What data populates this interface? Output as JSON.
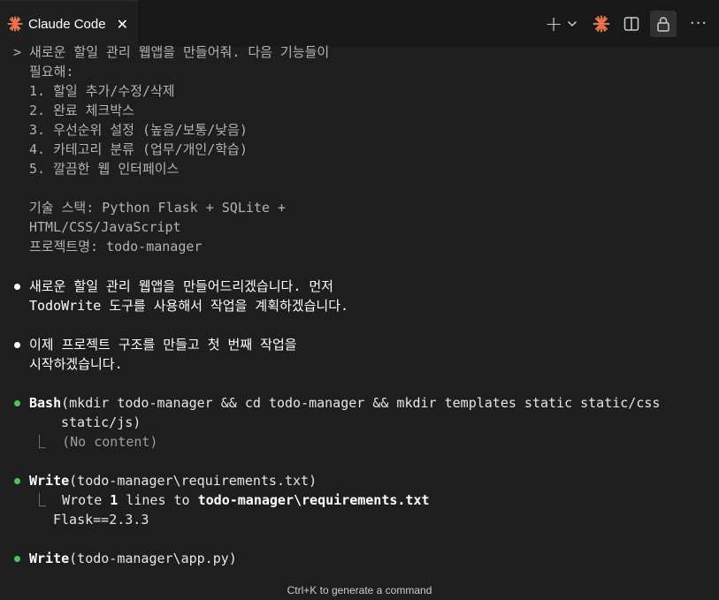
{
  "tab": {
    "title": "Claude Code",
    "close_glyph": "✕"
  },
  "actions": {
    "plus": "+",
    "more": "···"
  },
  "colors": {
    "accent_orange": "#e8734a",
    "bullet_green": "#4ec35a",
    "background": "#1e1e1e"
  },
  "conversation": {
    "prompt_marker": ">",
    "user_lines": [
      "새로운 할일 관리 웹앱을 만들어줘. 다음 기능들이",
      "필요해:",
      "1. 할일 추가/수정/삭제",
      "2. 완료 체크박스",
      "3. 우선순위 설정 (높음/보통/낮음)",
      "4. 카테고리 분류 (업무/개인/학습)",
      "5. 깔끔한 웹 인터페이스",
      "",
      "기술 스택: Python Flask + SQLite +",
      "HTML/CSS/JavaScript",
      "프로젝트명: todo-manager"
    ],
    "assistant_1": [
      "새로운 할일 관리 웹앱을 만들어드리겠습니다. 먼저",
      "TodoWrite 도구를 사용해서 작업을 계획하겠습니다."
    ],
    "assistant_2": [
      "이제 프로젝트 구조를 만들고 첫 번째 작업을",
      "시작하겠습니다."
    ],
    "tool_bash": {
      "name": "Bash",
      "args_line1": "(mkdir todo-manager && cd todo-manager && mkdir templates static static/css",
      "args_line2": "static/js)",
      "result_marker": "⎿",
      "result": "(No content)"
    },
    "tool_write_1": {
      "name": "Write",
      "args": "(todo-manager\\requirements.txt)",
      "result_marker": "⎿",
      "result_prefix": "Wrote ",
      "result_count": "1",
      "result_mid": " lines to ",
      "result_path": "todo-manager\\requirements.txt",
      "result_content": "Flask==2.3.3"
    },
    "tool_write_2": {
      "name": "Write",
      "args": "(todo-manager\\app.py)"
    }
  },
  "footer": {
    "hint": "Ctrl+K to generate a command"
  }
}
